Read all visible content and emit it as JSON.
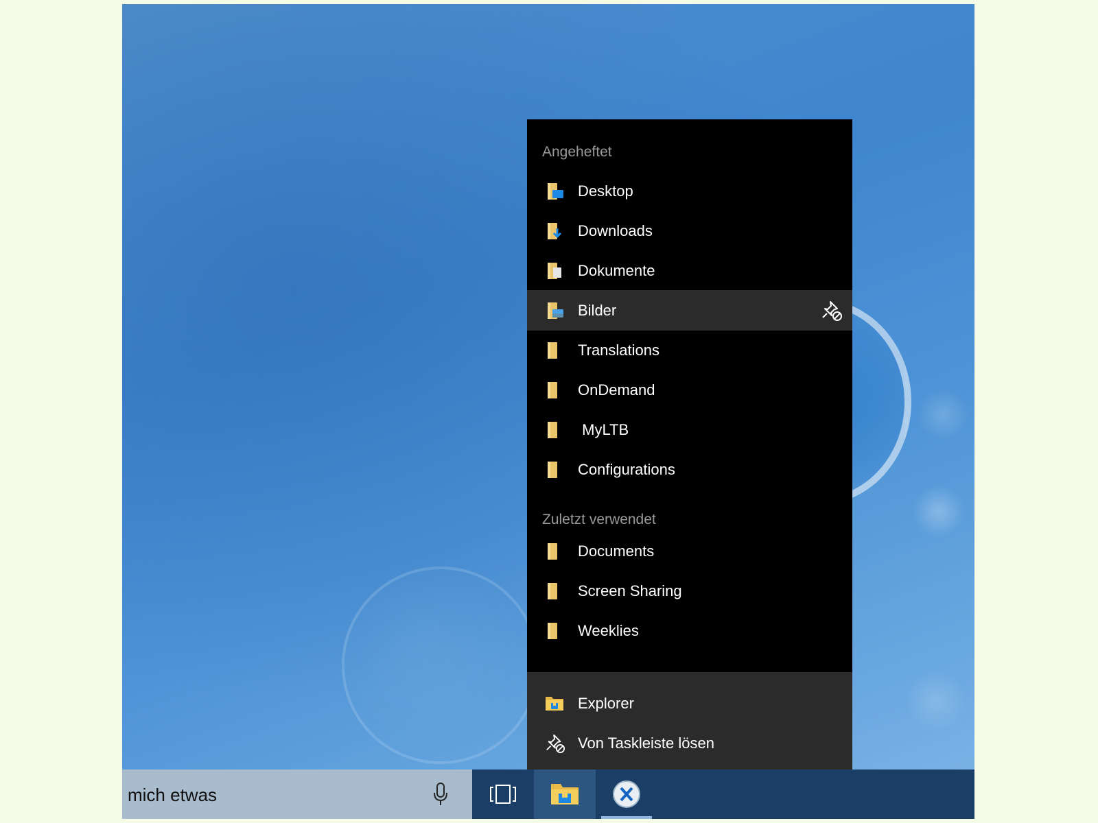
{
  "jumplist": {
    "pinned_header": "Angeheftet",
    "pinned_items": [
      {
        "label": "Desktop",
        "icon": "desktop-folder-icon"
      },
      {
        "label": "Downloads",
        "icon": "downloads-folder-icon"
      },
      {
        "label": "Dokumente",
        "icon": "documents-folder-icon"
      },
      {
        "label": "Bilder",
        "icon": "pictures-folder-icon",
        "hovered": true
      },
      {
        "label": "Translations",
        "icon": "folder-icon"
      },
      {
        "label": "OnDemand",
        "icon": "folder-icon"
      },
      {
        "label": " MyLTB",
        "icon": "folder-icon"
      },
      {
        "label": "Configurations",
        "icon": "folder-icon"
      }
    ],
    "recent_header": "Zuletzt verwendet",
    "recent_items": [
      {
        "label": "Documents",
        "icon": "folder-icon"
      },
      {
        "label": "Screen Sharing",
        "icon": "folder-icon"
      },
      {
        "label": "Weeklies",
        "icon": "folder-icon"
      }
    ],
    "footer_items": [
      {
        "label": "Explorer",
        "icon": "file-explorer-icon"
      },
      {
        "label": "Von Taskleiste lösen",
        "icon": "unpin-icon"
      }
    ]
  },
  "taskbar": {
    "search_text": "mich etwas",
    "buttons": [
      "microphone-icon",
      "task-view-icon",
      "file-explorer-icon",
      "app-x-icon"
    ]
  },
  "colors": {
    "folder": "#e9c46a",
    "jumplist_bg": "#000000",
    "jumplist_footer": "#2b2b2b",
    "taskbar": "#1a3e66",
    "accent": "#1e88e5"
  }
}
